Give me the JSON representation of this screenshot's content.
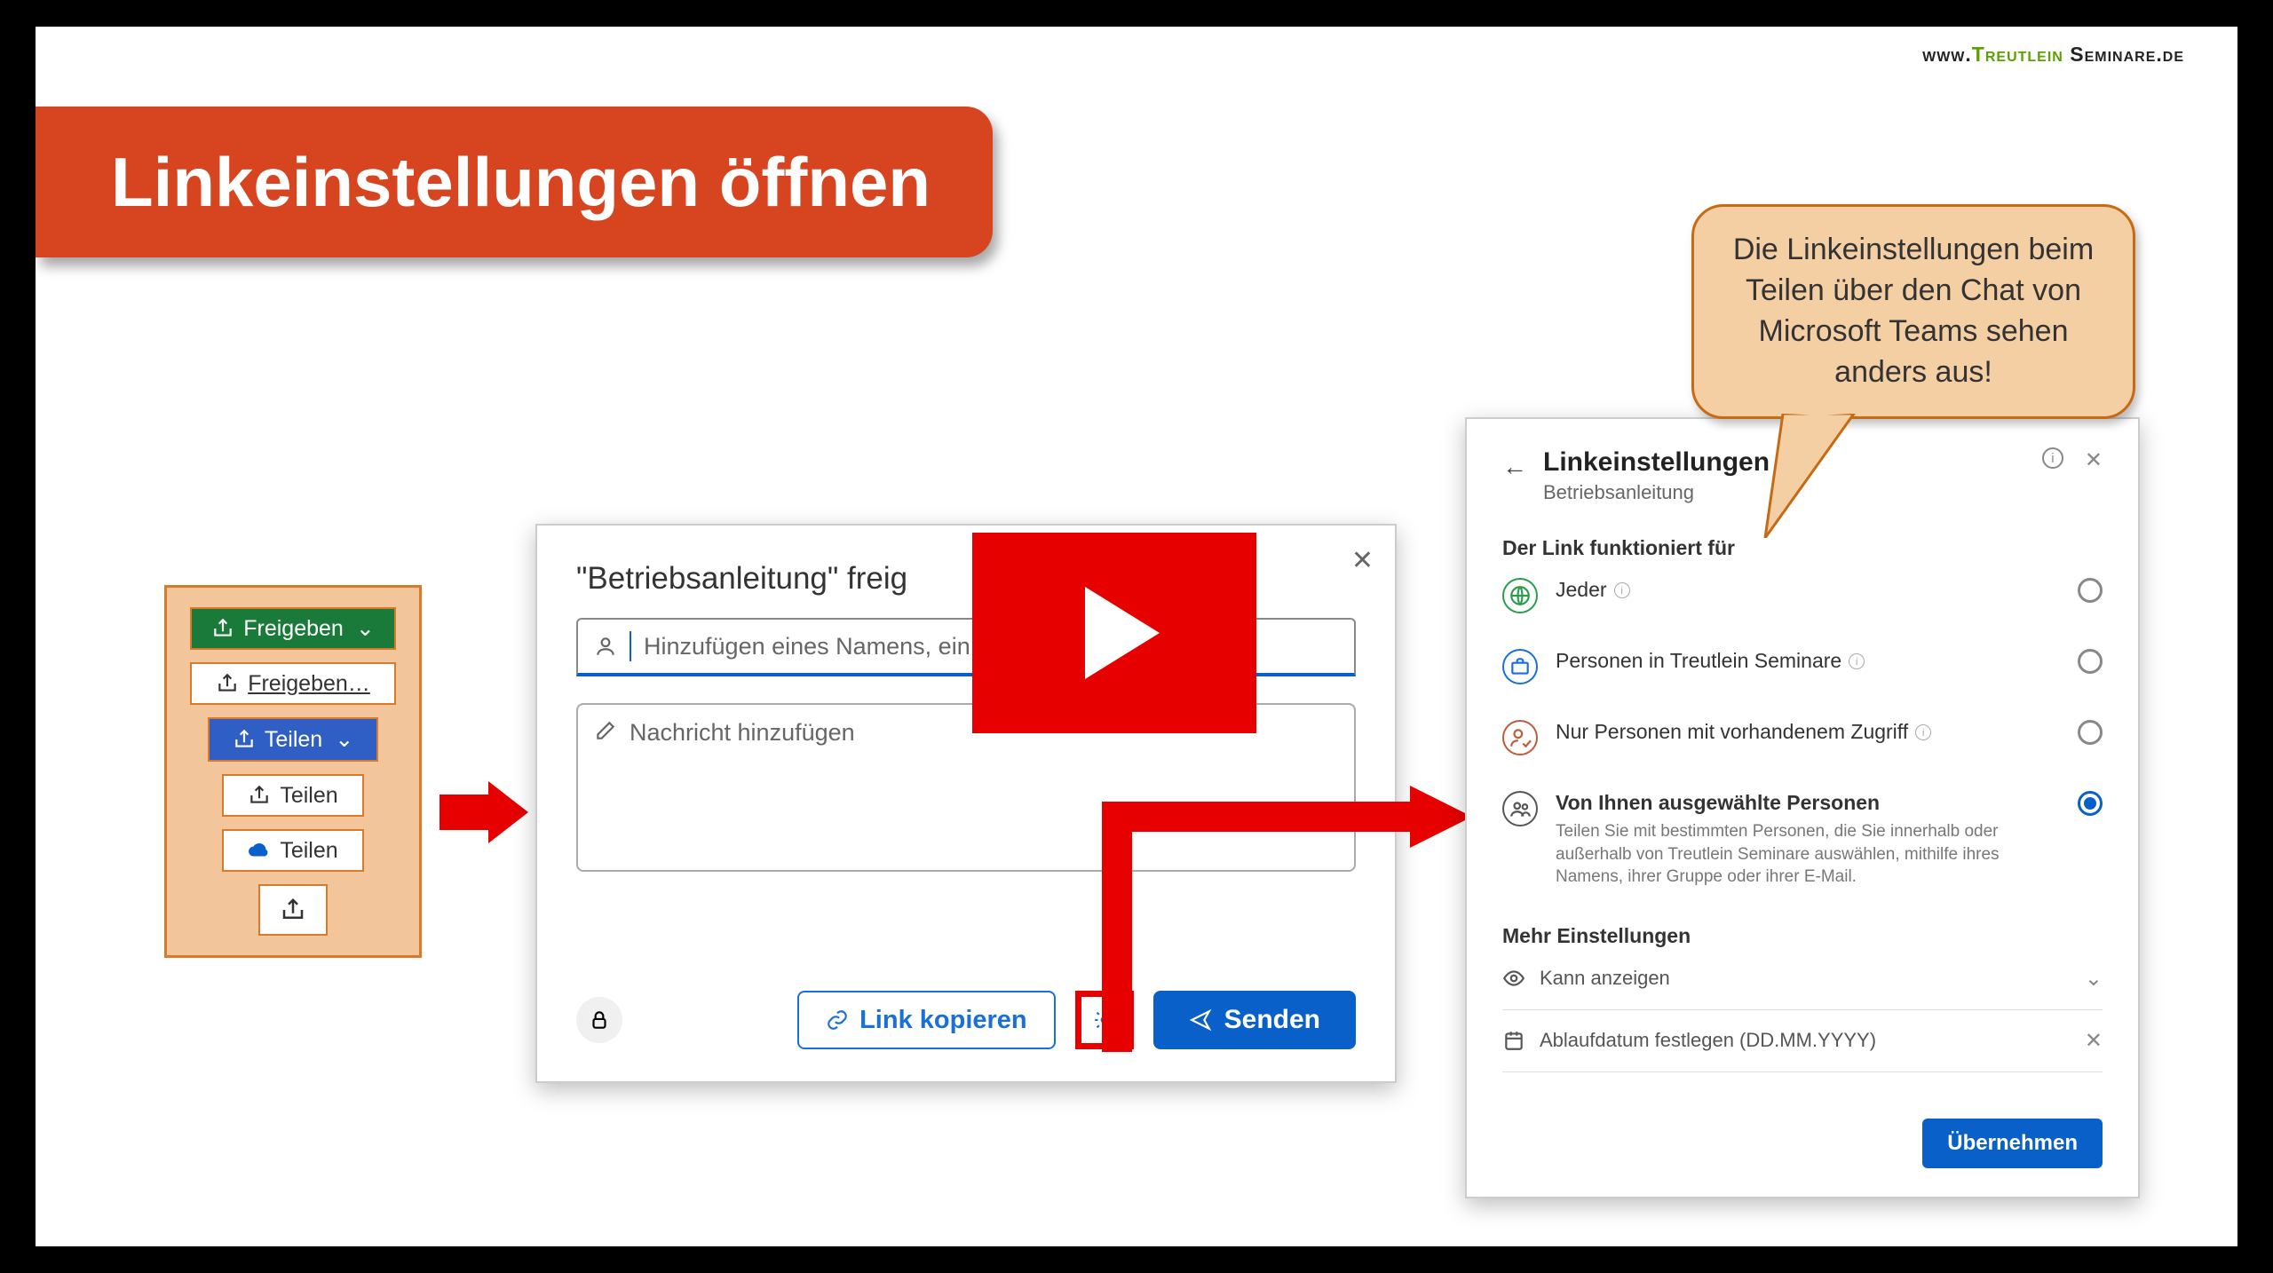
{
  "brand": {
    "pre": "www.",
    "accent": "Treutlein",
    "post": " Seminare.de"
  },
  "title": "Linkeinstellungen öffnen",
  "left_buttons": {
    "freigeben_green": "Freigeben",
    "freigeben_white": "Freigeben…",
    "teilen_blue": "Teilen",
    "teilen_white": "Teilen",
    "teilen_onedrive": "Teilen"
  },
  "share_dialog": {
    "title": "\"Betriebsanleitung\" freig",
    "name_placeholder": "Hinzufügen eines Namens, ein",
    "msg_placeholder": "Nachricht hinzufügen",
    "copy_link": "Link kopieren",
    "send": "Senden"
  },
  "settings_panel": {
    "title": "Linkeinstellungen",
    "subtitle": "Betriebsanleitung",
    "section_label": "Der Link funktioniert für",
    "opt_anyone": "Jeder",
    "opt_org": "Personen in Treutlein Seminare",
    "opt_existing": "Nur Personen mit vorhandenem Zugriff",
    "opt_specific": "Von Ihnen ausgewählte Personen",
    "opt_specific_desc": "Teilen Sie mit bestimmten Personen, die Sie innerhalb oder außerhalb von Treutlein Seminare auswählen, mithilfe ihres Namens, ihrer Gruppe oder ihrer E-Mail.",
    "more_label": "Mehr Einstellungen",
    "perm_view": "Kann anzeigen",
    "expiry_placeholder": "Ablaufdatum festlegen (DD.MM.YYYY)",
    "apply": "Übernehmen"
  },
  "bubble_text": "Die Linkeinstellungen beim Teilen über den Chat von Microsoft Teams sehen anders aus!"
}
